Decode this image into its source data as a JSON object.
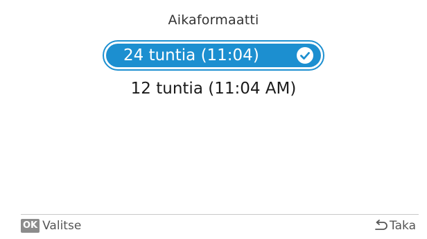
{
  "screen": {
    "title": "Aikaformaatti"
  },
  "options": [
    {
      "label": "24 tuntia (11:04)",
      "selected": true,
      "icon": "check-circle-icon"
    },
    {
      "label": "12 tuntia (11:04 AM)",
      "selected": false
    }
  ],
  "footer": {
    "ok_badge": "OK",
    "select_label": "Valitse",
    "back_label": "Taka",
    "back_icon": "back-arrow-icon"
  },
  "colors": {
    "accent": "#1c8fd0",
    "text": "#1a1a1a",
    "muted": "#555555",
    "badge": "#8c8c8c"
  }
}
